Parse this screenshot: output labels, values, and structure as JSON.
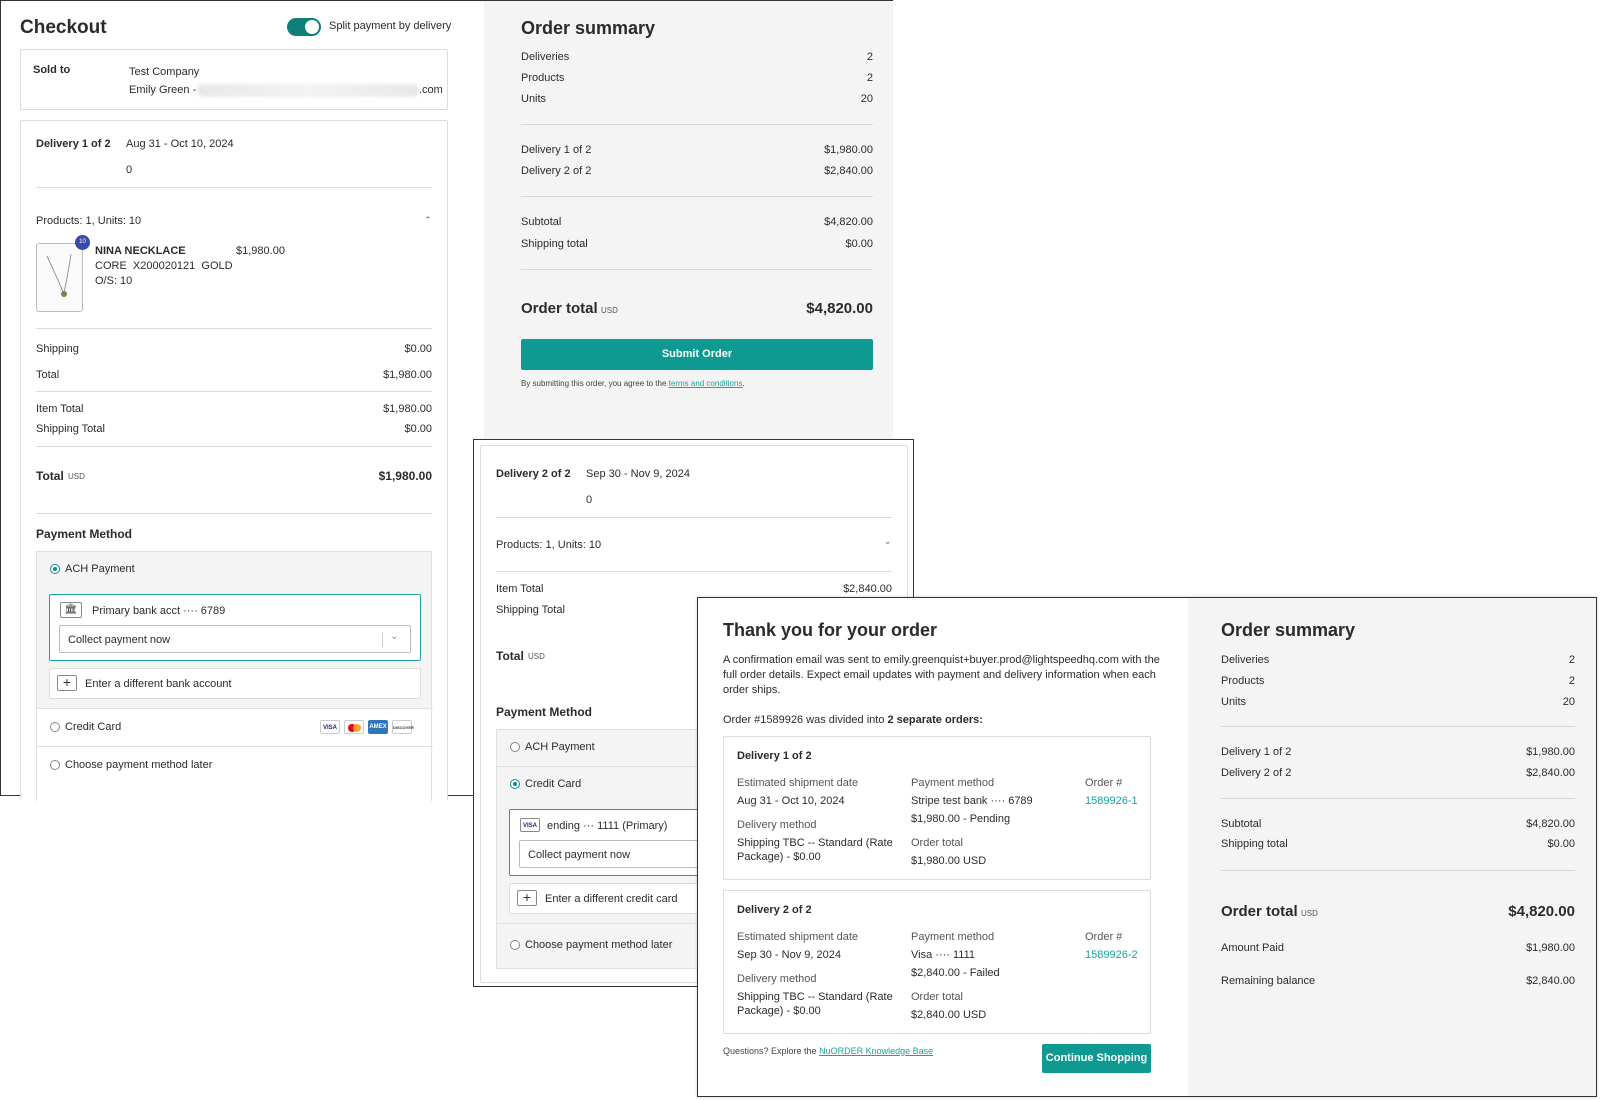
{
  "checkout": {
    "title": "Checkout",
    "split_label": "Split payment by delivery",
    "sold_to_label": "Sold to",
    "company": "Test Company",
    "contact_prefix": "Emily Green - e",
    "contact_suffix": ".com",
    "delivery1": {
      "label": "Delivery 1 of 2",
      "dates": "Aug 31 - Oct 10, 2024",
      "zero": "0",
      "products_units": "Products: 1, Units: 10",
      "product_name": "NINA NECKLACE",
      "product_sku": "CORE  X200020121  GOLD",
      "product_size": "O/S: 10",
      "product_price": "$1,980.00",
      "qty_badge": "10",
      "shipping_label": "Shipping",
      "shipping_value": "$0.00",
      "total_label": "Total",
      "total_value": "$1,980.00",
      "item_total_label": "Item Total",
      "item_total_value": "$1,980.00",
      "shipping_total_label": "Shipping Total",
      "shipping_total_value": "$0.00",
      "grand_total_label": "Total",
      "currency": "USD",
      "grand_total_value": "$1,980.00"
    },
    "payment": {
      "heading": "Payment Method",
      "ach_label": "ACH Payment",
      "bank_label": "Primary bank acct ···· 6789",
      "collect_label": "Collect payment now",
      "different_bank": "Enter a different bank account",
      "credit_label": "Credit Card",
      "later_label": "Choose payment method later"
    }
  },
  "summary1": {
    "title": "Order summary",
    "rows1": [
      {
        "label": "Deliveries",
        "value": "2"
      },
      {
        "label": "Products",
        "value": "2"
      },
      {
        "label": "Units",
        "value": "20"
      }
    ],
    "rows2": [
      {
        "label": "Delivery 1 of 2",
        "value": "$1,980.00"
      },
      {
        "label": "Delivery 2 of 2",
        "value": "$2,840.00"
      }
    ],
    "rows3": [
      {
        "label": "Subtotal",
        "value": "$4,820.00"
      },
      {
        "label": "Shipping total",
        "value": "$0.00"
      }
    ],
    "order_total_label": "Order total",
    "currency": "USD",
    "order_total_value": "$4,820.00",
    "submit_label": "Submit Order",
    "terms_prefix": "By submitting this order, you agree to the ",
    "terms_link": "terms and conditions",
    "terms_suffix": "."
  },
  "delivery2": {
    "label": "Delivery 2 of 2",
    "dates": "Sep 30 - Nov 9, 2024",
    "zero": "0",
    "products_units": "Products: 1, Units: 10",
    "item_total_label": "Item Total",
    "item_total_value": "$2,840.00",
    "shipping_total_label": "Shipping Total",
    "total_label": "Total",
    "currency": "USD",
    "payment_heading": "Payment Method",
    "ach_label": "ACH Payment",
    "credit_label": "Credit Card",
    "card_label": "ending ··· 1111 (Primary)",
    "collect_label": "Collect payment now",
    "different_card": "Enter a different credit card",
    "later_label": "Choose payment method later"
  },
  "thankyou": {
    "title": "Thank you for your order",
    "body_lines": [
      "A confirmation email was sent to emily.greenquist+buyer.prod@lightspeedhq.com with the",
      "full order details. Expect email updates with payment and delivery information when each",
      "order ships."
    ],
    "divided_prefix": "Order #1589926 was divided into ",
    "divided_bold": "2 separate orders:",
    "orders": [
      {
        "title": "Delivery 1 of 2",
        "ship_date_label": "Estimated shipment date",
        "ship_date": "Aug 31 - Oct 10, 2024",
        "delivery_method_label": "Delivery method",
        "delivery_method_l1": "Shipping TBC -- Standard (Rate",
        "delivery_method_l2": "Package) - $0.00",
        "payment_method_label": "Payment method",
        "payment_method": "Stripe test bank ···· 6789",
        "payment_status": "$1,980.00 - Pending",
        "order_total_label": "Order total",
        "order_total": "$1,980.00 USD",
        "order_num_label": "Order #",
        "order_num": "1589926-1"
      },
      {
        "title": "Delivery 2 of 2",
        "ship_date_label": "Estimated shipment date",
        "ship_date": "Sep 30 - Nov 9, 2024",
        "delivery_method_label": "Delivery method",
        "delivery_method_l1": "Shipping TBC -- Standard (Rate",
        "delivery_method_l2": "Package) - $0.00",
        "payment_method_label": "Payment method",
        "payment_method": "Visa ···· 1111",
        "payment_status": "$2,840.00 - Failed",
        "order_total_label": "Order total",
        "order_total": "$2,840.00 USD",
        "order_num_label": "Order #",
        "order_num": "1589926-2"
      }
    ],
    "questions_prefix": "Questions? Explore the ",
    "questions_link": "NuORDER Knowledge Base",
    "continue_label": "Continue Shopping"
  },
  "summary2": {
    "title": "Order summary",
    "rows1": [
      {
        "label": "Deliveries",
        "value": "2"
      },
      {
        "label": "Products",
        "value": "2"
      },
      {
        "label": "Units",
        "value": "20"
      }
    ],
    "rows2": [
      {
        "label": "Delivery 1 of 2",
        "value": "$1,980.00"
      },
      {
        "label": "Delivery 2 of 2",
        "value": "$2,840.00"
      }
    ],
    "rows3": [
      {
        "label": "Subtotal",
        "value": "$4,820.00"
      },
      {
        "label": "Shipping total",
        "value": "$0.00"
      }
    ],
    "order_total_label": "Order total",
    "currency": "USD",
    "order_total_value": "$4,820.00",
    "amount_paid_label": "Amount Paid",
    "amount_paid_value": "$1,980.00",
    "remaining_label": "Remaining balance",
    "remaining_value": "$2,840.00"
  },
  "card_brands": {
    "visa": "VISA",
    "amex": "AMEX",
    "discover": "DISCOVER"
  },
  "colors": {
    "accent": "#0f9a91",
    "link": "#19a39a",
    "badge": "#3b4aa8"
  }
}
